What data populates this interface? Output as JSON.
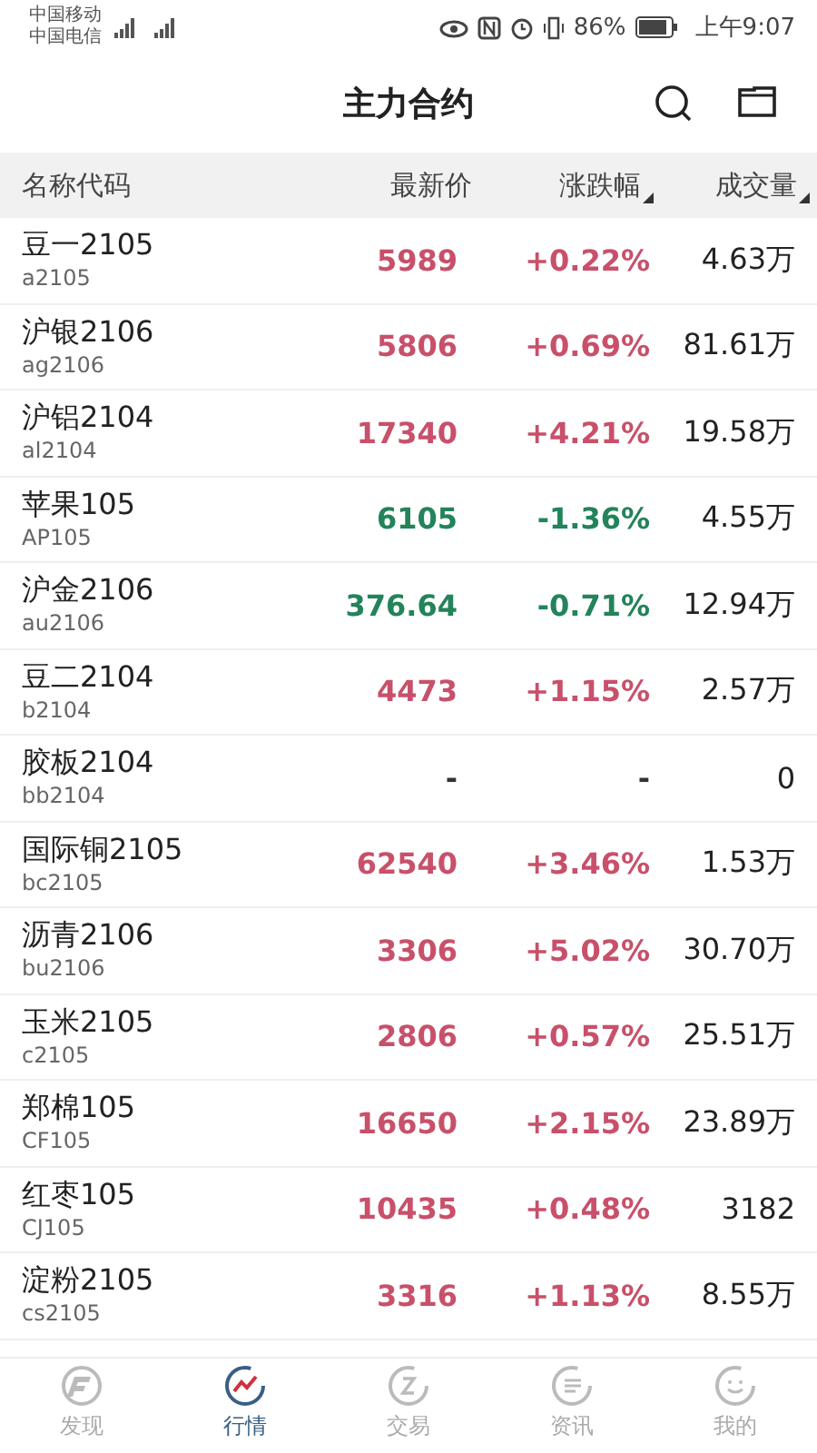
{
  "status_bar": {
    "carrier_1": "中国移动",
    "carrier_2": "中国电信",
    "battery": "86%",
    "time": "上午9:07"
  },
  "title": "主力合约",
  "table": {
    "columns": [
      {
        "label": "名称代码",
        "sortable": false
      },
      {
        "label": "最新价",
        "sortable": false
      },
      {
        "label": "涨跌幅",
        "sortable": true
      },
      {
        "label": "成交量",
        "sortable": true
      }
    ],
    "rows": [
      {
        "name": "豆一2105",
        "code": "a2105",
        "price": "5989",
        "change": "+0.22%",
        "volume": "4.63万",
        "color": "#c8506a"
      },
      {
        "name": "沪银2106",
        "code": "ag2106",
        "price": "5806",
        "change": "+0.69%",
        "volume": "81.61万",
        "color": "#c8506a"
      },
      {
        "name": "沪铝2104",
        "code": "al2104",
        "price": "17340",
        "change": "+4.21%",
        "volume": "19.58万",
        "color": "#c8506a"
      },
      {
        "name": "苹果105",
        "code": "AP105",
        "price": "6105",
        "change": "-1.36%",
        "volume": "4.55万",
        "color": "#23835a"
      },
      {
        "name": "沪金2106",
        "code": "au2106",
        "price": "376.64",
        "change": "-0.71%",
        "volume": "12.94万",
        "color": "#23835a"
      },
      {
        "name": "豆二2104",
        "code": "b2104",
        "price": "4473",
        "change": "+1.15%",
        "volume": "2.57万",
        "color": "#c8506a"
      },
      {
        "name": "胶板2104",
        "code": "bb2104",
        "price": "-",
        "change": "-",
        "volume": "0",
        "color": "#333333"
      },
      {
        "name": "国际铜2105",
        "code": "bc2105",
        "price": "62540",
        "change": "+3.46%",
        "volume": "1.53万",
        "color": "#c8506a"
      },
      {
        "name": "沥青2106",
        "code": "bu2106",
        "price": "3306",
        "change": "+5.02%",
        "volume": "30.70万",
        "color": "#c8506a"
      },
      {
        "name": "玉米2105",
        "code": "c2105",
        "price": "2806",
        "change": "+0.57%",
        "volume": "25.51万",
        "color": "#c8506a"
      },
      {
        "name": "郑棉105",
        "code": "CF105",
        "price": "16650",
        "change": "+2.15%",
        "volume": "23.89万",
        "color": "#c8506a"
      },
      {
        "name": "红枣105",
        "code": "CJ105",
        "price": "10435",
        "change": "+0.48%",
        "volume": "3182",
        "color": "#c8506a"
      },
      {
        "name": "淀粉2105",
        "code": "cs2105",
        "price": "3316",
        "change": "+1.13%",
        "volume": "8.55万",
        "color": "#c8506a"
      }
    ]
  },
  "tabs": [
    {
      "label": "发现",
      "selected": false
    },
    {
      "label": "行情",
      "selected": true
    },
    {
      "label": "交易",
      "selected": false
    },
    {
      "label": "资讯",
      "selected": false
    },
    {
      "label": "我的",
      "selected": false
    }
  ]
}
